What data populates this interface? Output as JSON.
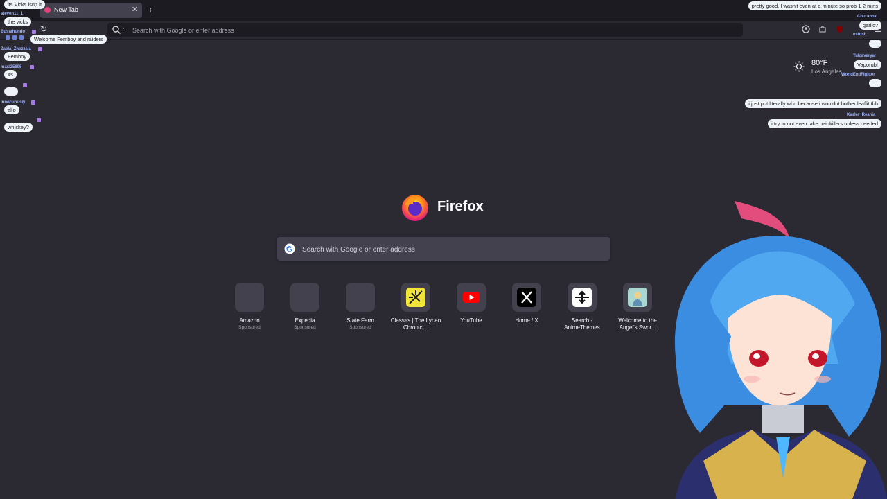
{
  "browser": {
    "tab": {
      "title": "New Tab"
    },
    "urlbar": {
      "placeholder": "Search with Google or enter address"
    }
  },
  "weather": {
    "temp": "80°F",
    "city": "Los Angeles"
  },
  "newtab": {
    "brand": "Firefox",
    "search_placeholder": "Search with Google or enter address",
    "shortcuts": [
      {
        "label": "Amazon",
        "sponsored": "Sponsored"
      },
      {
        "label": "Expedia",
        "sponsored": "Sponsored"
      },
      {
        "label": "State Farm",
        "sponsored": "Sponsored"
      },
      {
        "label": "Classes | The Lyrian Chronicl...",
        "sponsored": ""
      },
      {
        "label": "YouTube",
        "sponsored": ""
      },
      {
        "label": "Home / X",
        "sponsored": ""
      },
      {
        "label": "Search - AnimeThemes",
        "sponsored": ""
      },
      {
        "label": "Welcome to the Angel's Swor...",
        "sponsored": ""
      }
    ]
  },
  "chat_left": [
    {
      "user": "",
      "text": "its Vicks isn;t it"
    },
    {
      "user": "steven11_1_",
      "text": "the vicks"
    },
    {
      "user": "Bustahundo",
      "text": "Welcome Femboy and raiders"
    },
    {
      "user": "Zaela_Zhezzala",
      "text": "Femboy"
    },
    {
      "user": "maxi25895",
      "text": "4s"
    },
    {
      "user": "",
      "text": ""
    },
    {
      "user": "innocuously",
      "text": "allo"
    },
    {
      "user": "",
      "text": "whiskey?"
    }
  ],
  "chat_right": [
    {
      "user": "",
      "text": "pretty good, I wasn't even at a minute so prob 1-2 mins"
    },
    {
      "user": "Couranox",
      "text": "garlic?"
    },
    {
      "user": "estosh",
      "text": ""
    },
    {
      "user": "Tulcavaryar",
      "text": "Vaporub!"
    },
    {
      "user": "WorldEndFighter",
      "text": ""
    },
    {
      "user": "",
      "text": "i just put literally who because i wouldnt bother leaflit tbh"
    },
    {
      "user": "Kasler_Reania",
      "text": "i try to not even take painkillers unless needed"
    }
  ]
}
